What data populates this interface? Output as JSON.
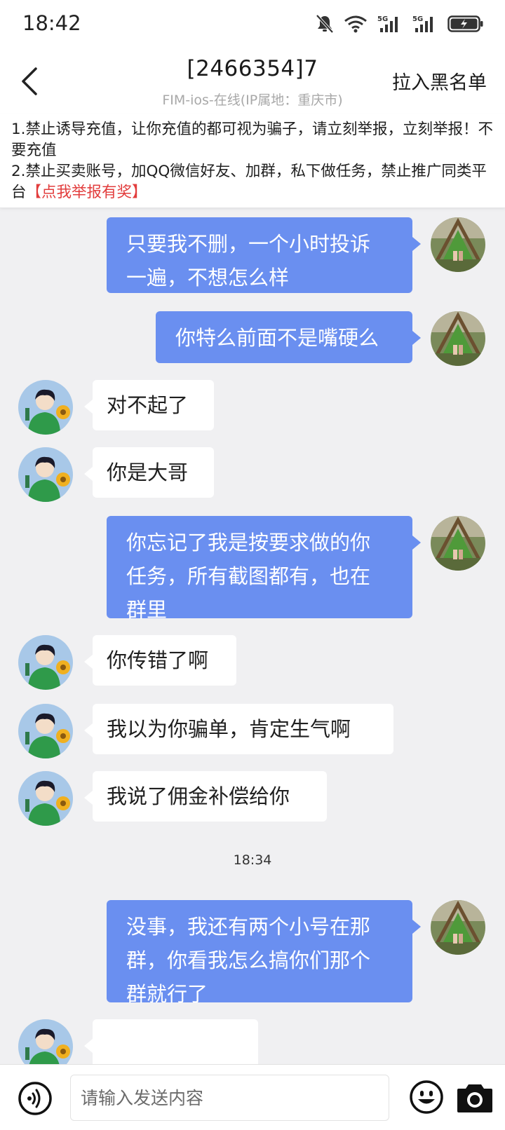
{
  "status_bar": {
    "time": "18:42",
    "icons": [
      "bell-muted-icon",
      "wifi-icon",
      "signal-5g-icon",
      "signal-5g-icon",
      "battery-charging-icon"
    ],
    "network_label": "5G"
  },
  "header": {
    "title": "[2466354]7",
    "subtitle": "FIM-ios-在线(IP属地：重庆市)",
    "blacklist_label": "拉入黑名单",
    "back_icon": "chevron-left-icon"
  },
  "notice": {
    "line1": "1.禁止诱导充值，让你充值的都可视为骗子，请立刻举报，立刻举报！不要充值",
    "line2": "2.禁止买卖账号，加QQ微信好友、加群，私下做任务，禁止推广同类平台",
    "report_link": "【点我举报有奖】",
    "report_color": "#e23d3d"
  },
  "colors": {
    "outgoing_bubble": "#6a8ff0",
    "incoming_bubble": "#ffffff",
    "chat_background": "#f0f0f2"
  },
  "messages": [
    {
      "side": "right",
      "lines": [
        "只要我不删，一个小时投诉",
        "一遍，不想怎么样"
      ]
    },
    {
      "side": "right",
      "lines": [
        "你特么前面不是嘴硬么"
      ]
    },
    {
      "side": "left",
      "lines": [
        "对不起了"
      ]
    },
    {
      "side": "left",
      "lines": [
        "你是大哥"
      ]
    },
    {
      "side": "right",
      "lines": [
        "你忘记了我是按要求做的你",
        "任务，所有截图都有，也在",
        "群里"
      ]
    },
    {
      "side": "left",
      "lines": [
        "你传错了啊"
      ]
    },
    {
      "side": "left",
      "lines": [
        "我以为你骗单，肯定生气啊"
      ]
    },
    {
      "side": "left",
      "lines": [
        "我说了佣金补偿给你"
      ]
    },
    {
      "side": "time",
      "lines": [
        "18:34"
      ]
    },
    {
      "side": "right",
      "lines": [
        "没事，我还有两个小号在那",
        "群，你看我怎么搞你们那个",
        "群就行了"
      ]
    },
    {
      "side": "left",
      "lines": [
        ""
      ]
    }
  ],
  "input_bar": {
    "placeholder": "请输入发送内容",
    "voice_icon": "voice-icon",
    "emoji_icon": "emoji-icon",
    "camera_icon": "camera-icon"
  }
}
